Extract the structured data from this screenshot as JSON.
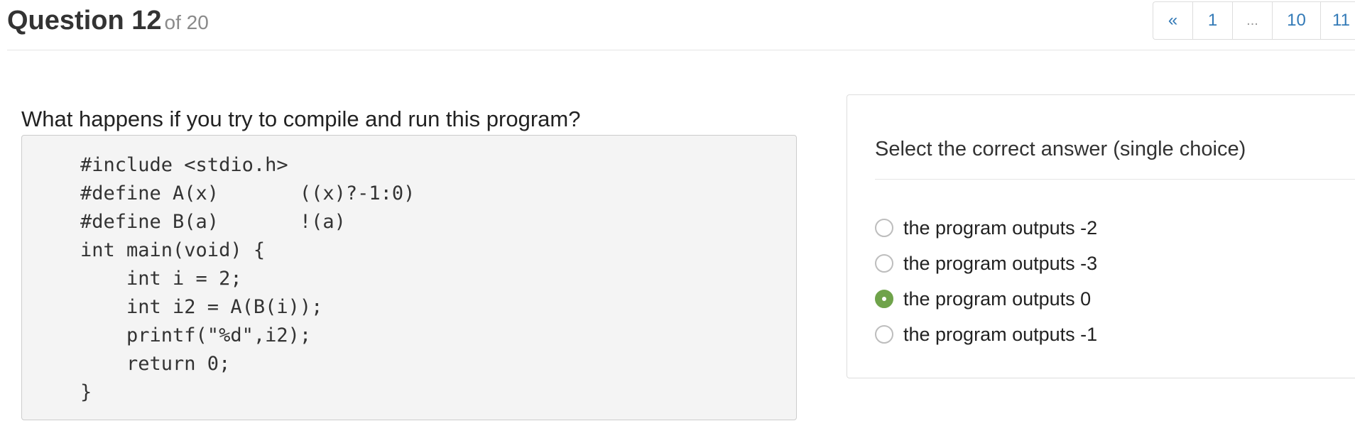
{
  "header": {
    "title": "Question 12",
    "subtitle": "of 20"
  },
  "pagination": {
    "prev": "«",
    "pages": [
      "1",
      "...",
      "10",
      "11"
    ]
  },
  "question": {
    "text": "What happens if you try to compile and run this program?",
    "code": "#include <stdio.h>\n#define A(x)       ((x)?-1:0)\n#define B(a)       !(a)\nint main(void) {\n    int i = 2;\n    int i2 = A(B(i));\n    printf(\"%d\",i2);\n    return 0;\n}"
  },
  "answer": {
    "heading": "Select the correct answer (single choice)",
    "options": [
      {
        "label": "the program outputs -2",
        "selected": false
      },
      {
        "label": "the program outputs -3",
        "selected": false
      },
      {
        "label": "the program outputs 0",
        "selected": true
      },
      {
        "label": "the program outputs -1",
        "selected": false
      }
    ],
    "selected_color": "#6fa34a"
  },
  "colors": {
    "link": "#337ab7",
    "code_bg": "#f4f4f4"
  }
}
